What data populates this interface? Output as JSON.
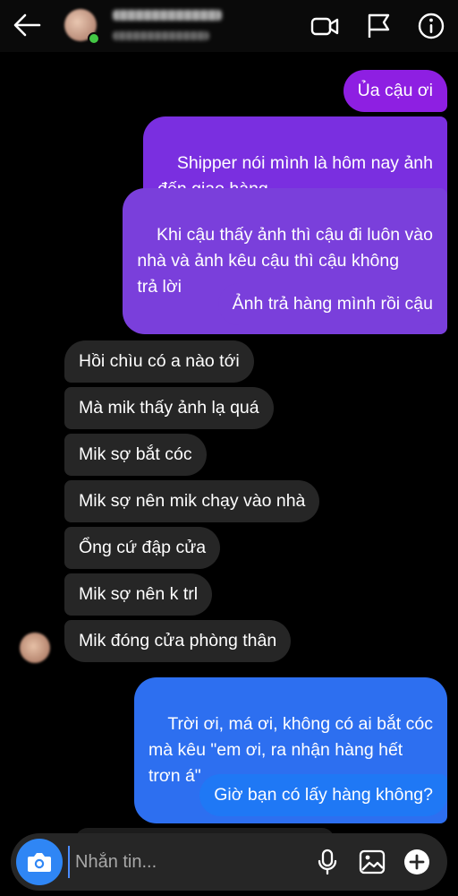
{
  "header": {
    "back_icon": "back-arrow-icon",
    "icons": [
      "video-call-icon",
      "flag-icon",
      "info-icon"
    ]
  },
  "messages": {
    "outgoing_1": [
      "Ủa cậu ơi",
      "Shipper nói mình là hôm nay ảnh\nđến giao hàng",
      "Khi cậu thấy ảnh thì cậu đi luôn vào\nnhà và ảnh kêu cậu thì cậu không\ntrả lời",
      "Ảnh trả hàng mình rồi cậu"
    ],
    "incoming": [
      "Hồi chìu có a nào tới",
      "Mà mik thấy ảnh lạ quá",
      "Mik sợ bắt cóc",
      "Mik sợ nên mik chạy vào nhà",
      "Ổng cứ đập cửa",
      "Mik sợ nên k trl",
      "Mik đóng cửa phòng thân"
    ],
    "outgoing_2": [
      "Trời ơi, má ơi, không có ai bắt cóc\nmà kêu \"em ơi, ra nhận hàng hết\ntrơn á\"",
      "Giờ bạn có lấy hàng không?"
    ]
  },
  "composer": {
    "placeholder": "Nhắn tin...",
    "icons": [
      "camera-icon",
      "microphone-icon",
      "gallery-icon",
      "plus-icon"
    ]
  },
  "colors": {
    "background": "#000000",
    "incoming_bubble": "#262626",
    "outgoing_purple": "#8e1fe2",
    "outgoing_blue": "#2d6ff0",
    "camera_button": "#2f86f5"
  }
}
